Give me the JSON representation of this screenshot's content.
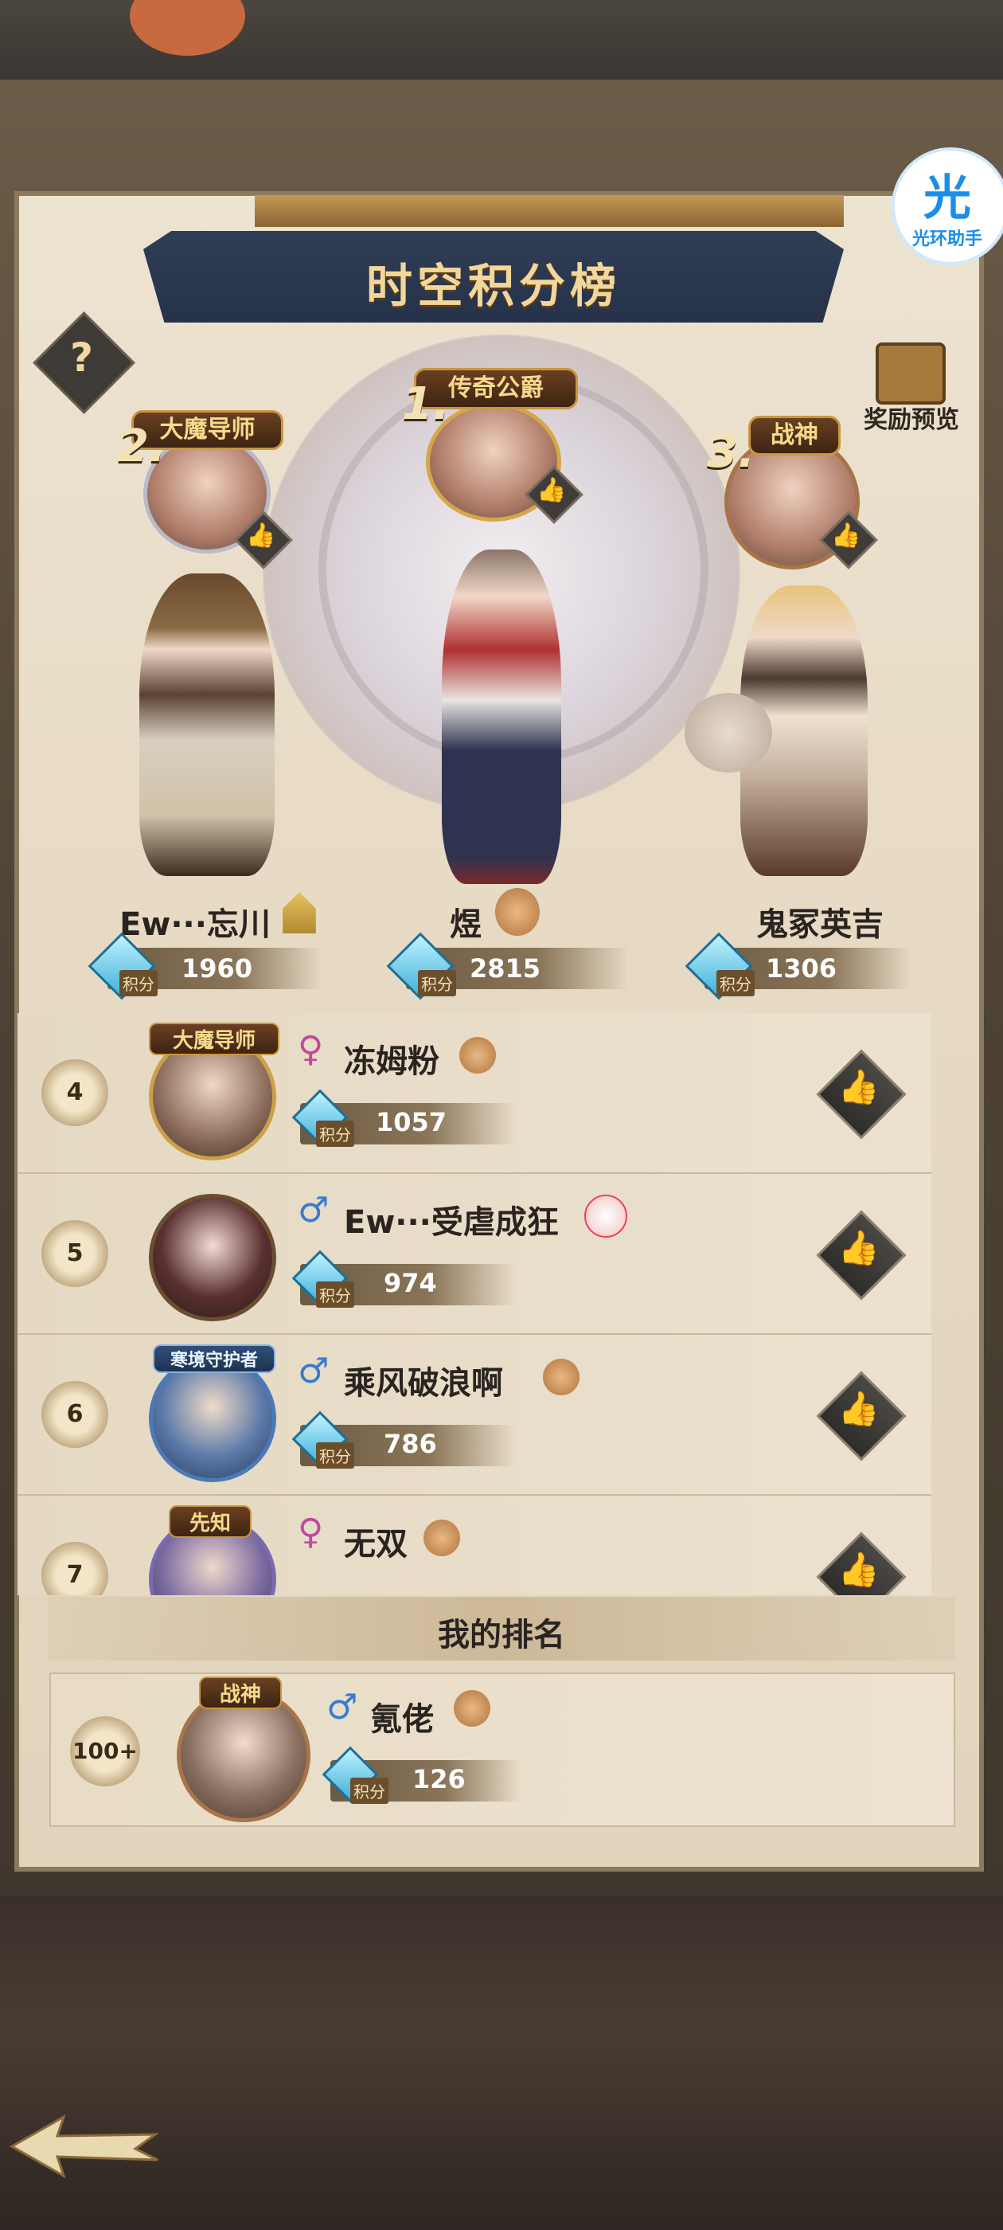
{
  "overlay": {
    "badge_icon_text": "光",
    "badge_label": "光环助手"
  },
  "board": {
    "title": "时空积分榜",
    "help_label": "?",
    "reward_label": "奖励预览",
    "score_tag": "积分"
  },
  "podium": [
    {
      "rank": "2.",
      "title": "大魔导师",
      "name": "Ew···忘川",
      "score": "1960",
      "pet_icon": "golden-castle-icon"
    },
    {
      "rank": "1.",
      "title": "传奇公爵",
      "name": "煜",
      "score": "2815",
      "pet_icon": "teddy-bear-icon"
    },
    {
      "rank": "3.",
      "title": "战神",
      "name": "鬼冢英吉",
      "score": "1306",
      "pet_icon": ""
    }
  ],
  "list": [
    {
      "rank": "4",
      "badge": "大魔导师",
      "gender": "♀",
      "name": "冻姆粉",
      "score": "1057",
      "pet_icon": "teddy-bear-icon"
    },
    {
      "rank": "5",
      "badge": "",
      "gender": "♂",
      "name": "Ew···受虐成狂",
      "score": "974",
      "pet_icon": "bunny-icon"
    },
    {
      "rank": "6",
      "badge": "寒境守护者",
      "gender": "♂",
      "name": "乘风破浪啊",
      "score": "786",
      "pet_icon": "teddy-bear-icon"
    },
    {
      "rank": "7",
      "badge": "先知",
      "gender": "♀",
      "name": "无双",
      "score": "",
      "pet_icon": "teddy-bear-icon"
    }
  ],
  "my_rank": {
    "header": "我的排名",
    "rank": "100+",
    "badge": "战神",
    "gender": "♂",
    "name": "氪佬",
    "score": "126",
    "pet_icon": "teddy-bear-icon"
  },
  "colors": {
    "title_gold": "#f3d79a",
    "board_paper": "#e8dcc6",
    "score_gem": "#3fb0d8",
    "female": "#c04aa0",
    "male": "#3a7ad0"
  }
}
